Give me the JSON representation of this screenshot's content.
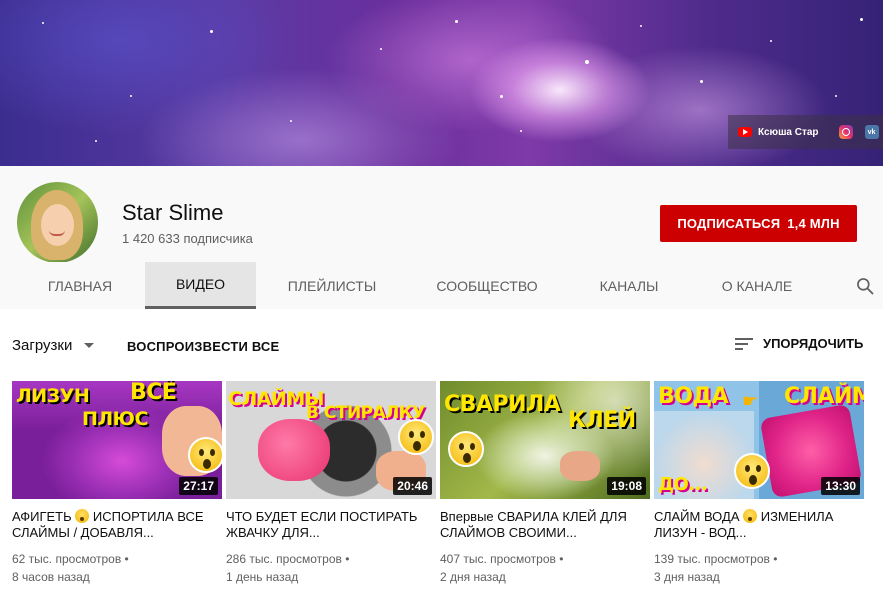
{
  "banner": {
    "social_label": "Ксюша Стар",
    "vk_label": "vk"
  },
  "channel": {
    "name": "Star Slime",
    "subscribers": "1 420 633 подписчика",
    "subscribe_label": "ПОДПИСАТЬСЯ",
    "subscribe_count": "1,4 МЛН"
  },
  "tabs": [
    {
      "label": "ГЛАВНАЯ",
      "active": false
    },
    {
      "label": "ВИДЕО",
      "active": true
    },
    {
      "label": "ПЛЕЙЛИСТЫ",
      "active": false
    },
    {
      "label": "СООБЩЕСТВО",
      "active": false
    },
    {
      "label": "КАНАЛЫ",
      "active": false
    },
    {
      "label": "О КАНАЛЕ",
      "active": false
    }
  ],
  "toolbar": {
    "uploads_label": "Загрузки",
    "play_all_label": "ВОСПРОИЗВЕСТИ ВСЕ",
    "sort_label": "УПОРЯДОЧИТЬ"
  },
  "videos": [
    {
      "thumb_text_1": "ЛИЗУН",
      "thumb_text_2": "ВСЁ",
      "thumb_text_3": "ПЛЮС",
      "duration": "27:17",
      "title_a": "АФИГЕТЬ",
      "title_b": "ИСПОРТИЛА ВСЕ СЛАЙМЫ / ДОБАВЛЯ...",
      "views": "62 тыс. просмотров •",
      "age": "8 часов назад"
    },
    {
      "thumb_text_1": "СЛАЙМЫ",
      "thumb_text_2": "В СТИРАЛКУ",
      "duration": "20:46",
      "title": "ЧТО БУДЕТ ЕСЛИ ПОСТИРАТЬ ЖВАЧКУ ДЛЯ...",
      "views": "286 тыс. просмотров •",
      "age": "1 день назад"
    },
    {
      "thumb_text_1": "СВАРИЛА",
      "thumb_text_2": "КЛЕЙ",
      "duration": "19:08",
      "title": "Впервые СВАРИЛА КЛЕЙ ДЛЯ СЛАЙМОВ СВОИМИ...",
      "views": "407 тыс. просмотров •",
      "age": "2 дня назад"
    },
    {
      "thumb_text_1": "ВОДА",
      "thumb_text_2": "СЛАЙМ",
      "thumb_text_3": "ДО...",
      "duration": "13:30",
      "title_a": "СЛАЙМ ВОДА",
      "title_b": "ИЗМЕНИЛА ЛИЗУН - ВОД...",
      "views": "139 тыс. просмотров •",
      "age": "3 дня назад"
    }
  ],
  "colors": {
    "subscribe_red": "#cc0000",
    "thumb_title_yellow": "#ffe600",
    "thumb_title_pink": "#ff3ad1"
  }
}
